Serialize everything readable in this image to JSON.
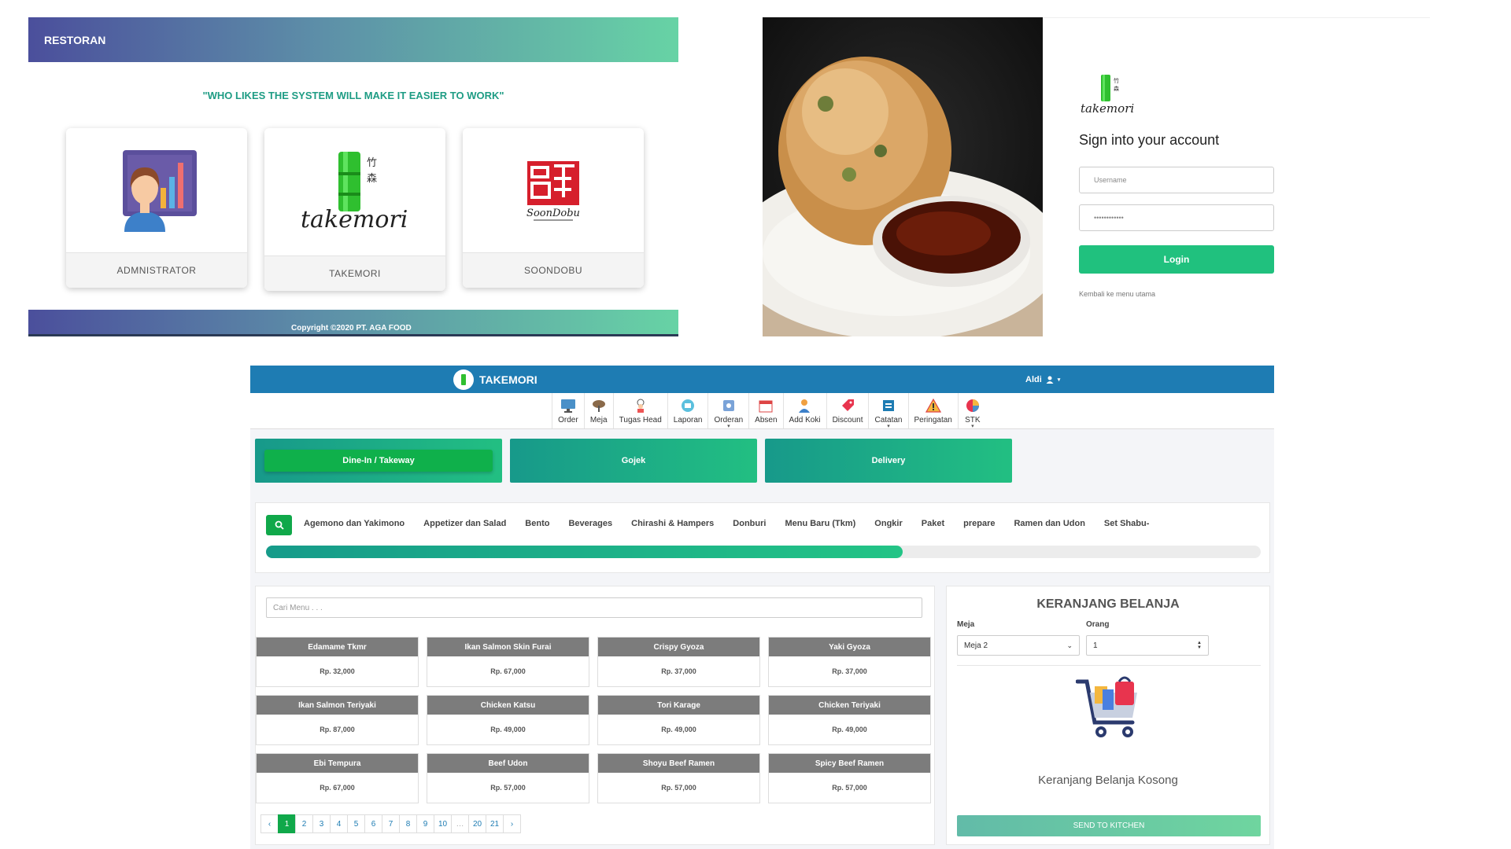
{
  "restoran_panel": {
    "header_title": "RESTORAN",
    "tagline": "\"WHO LIKES THE SYSTEM WILL MAKE IT EASIER TO WORK\"",
    "cards": [
      {
        "label": "ADMNISTRATOR",
        "icon": "admin-chart-icon"
      },
      {
        "label": "TAKEMORI",
        "icon": "takemori-logo"
      },
      {
        "label": "SOONDOBU",
        "icon": "soondobu-logo"
      }
    ],
    "footer": "Copyright ©2020 PT. AGA FOOD",
    "logo_text": {
      "takemori": "takemori",
      "soondobu": "SoonDobu"
    }
  },
  "login_panel": {
    "title": "Sign into your account",
    "username_placeholder": "Username",
    "password_mask": "••••••••••••",
    "login_button": "Login",
    "back_link": "Kembali ke menu utama",
    "logo_text": "takemori"
  },
  "pos": {
    "brand": "TAKEMORI",
    "user": "Aldi",
    "nav": [
      {
        "label": "Order",
        "icon": "monitor-icon"
      },
      {
        "label": "Meja",
        "icon": "table-icon"
      },
      {
        "label": "Tugas Head",
        "icon": "chef-icon"
      },
      {
        "label": "Laporan",
        "icon": "report-icon"
      },
      {
        "label": "Orderan",
        "icon": "orders-icon"
      },
      {
        "label": "Absen",
        "icon": "calendar-icon"
      },
      {
        "label": "Add Koki",
        "icon": "add-user-icon"
      },
      {
        "label": "Discount",
        "icon": "discount-tag-icon"
      },
      {
        "label": "Catatan",
        "icon": "notes-icon"
      },
      {
        "label": "Peringatan",
        "icon": "warning-icon"
      },
      {
        "label": "STK",
        "icon": "stock-icon"
      }
    ],
    "modes": [
      "Dine-In / Takeway",
      "Gojek",
      "Delivery"
    ],
    "active_mode": "Dine-In / Takeway",
    "categories": [
      "Agemono dan Yakimono",
      "Appetizer dan Salad",
      "Bento",
      "Beverages",
      "Chirashi & Hampers",
      "Donburi",
      "Menu Baru (Tkm)",
      "Ongkir",
      "Paket",
      "prepare",
      "Ramen dan Udon",
      "Set Shabu-"
    ],
    "category_scroll_fraction": 0.64,
    "search_placeholder": "Cari Menu . . .",
    "menu_items": [
      {
        "name": "Edamame Tkmr",
        "price": "Rp. 32,000"
      },
      {
        "name": "Ikan Salmon Skin Furai",
        "price": "Rp. 67,000"
      },
      {
        "name": "Crispy Gyoza",
        "price": "Rp. 37,000"
      },
      {
        "name": "Yaki Gyoza",
        "price": "Rp. 37,000"
      },
      {
        "name": "Ikan Salmon Teriyaki",
        "price": "Rp. 87,000"
      },
      {
        "name": "Chicken Katsu",
        "price": "Rp. 49,000"
      },
      {
        "name": "Tori Karage",
        "price": "Rp. 49,000"
      },
      {
        "name": "Chicken Teriyaki",
        "price": "Rp. 49,000"
      },
      {
        "name": "Ebi Tempura",
        "price": "Rp. 67,000"
      },
      {
        "name": "Beef Udon",
        "price": "Rp. 57,000"
      },
      {
        "name": "Shoyu Beef Ramen",
        "price": "Rp. 57,000"
      },
      {
        "name": "Spicy Beef Ramen",
        "price": "Rp. 57,000"
      }
    ],
    "pagination": [
      "‹",
      "1",
      "2",
      "3",
      "4",
      "5",
      "6",
      "7",
      "8",
      "9",
      "10",
      "…",
      "20",
      "21",
      "›"
    ],
    "current_page": "1",
    "cart": {
      "title": "KERANJANG BELANJA",
      "meja_label": "Meja",
      "meja_value": "Meja 2",
      "orang_label": "Orang",
      "orang_value": "1",
      "empty_text": "Keranjang Belanja Kosong",
      "send_button": "SEND TO KITCHEN"
    }
  },
  "colors": {
    "brand_blue": "#1e7cb3",
    "green_accent": "#20c17e",
    "teal_gradient_start": "#17998a",
    "header_gradient_start": "#4b4f9c",
    "header_gradient_end": "#67d3a5"
  }
}
